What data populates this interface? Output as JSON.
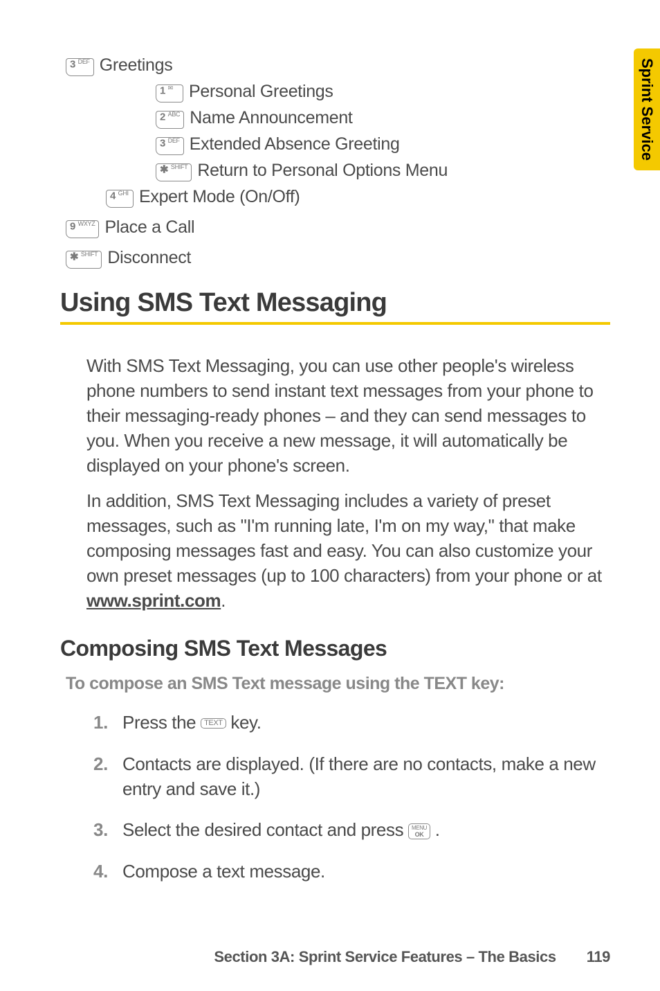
{
  "tab": "Sprint Service",
  "menu": {
    "greetings": {
      "key": "3 DEF",
      "label": "Greetings"
    },
    "personal": {
      "key": "1",
      "label": "Personal Greetings"
    },
    "name_ann": {
      "key": "2 ABC",
      "label": "Name Announcement"
    },
    "ext_abs": {
      "key": "3 DEF",
      "label": "Extended Absence Greeting"
    },
    "return_opts": {
      "key": "* SHIFT",
      "label": "Return to Personal Options Menu"
    },
    "expert": {
      "key": "4 GHI",
      "label": "Expert Mode (On/Off)"
    },
    "place_call": {
      "key": "9 WXYZ",
      "label": "Place a Call"
    },
    "disconnect": {
      "key": "* SHIFT",
      "label": "Disconnect"
    }
  },
  "heading": "Using SMS Text Messaging",
  "para1": "With SMS Text Messaging, you can use other people's wireless phone numbers to send instant text messages from your phone to their messaging-ready phones – and they can send messages to you. When you receive a new message, it will automatically be displayed on your phone's screen.",
  "para2a": "In addition, SMS Text Messaging includes a variety of preset messages, such as \"I'm running late, I'm on my way,\" that make composing messages fast and easy. You can also customize your own preset messages (up to 100 characters) from your phone or at ",
  "para2_link": "www.sprint.com",
  "para2b": ".",
  "subheading": "Composing SMS Text Messages",
  "instruction": "To compose an SMS Text message using the TEXT key:",
  "steps": {
    "s1a": "Press the ",
    "s1key": "TEXT",
    "s1b": " key.",
    "s2": "Contacts are displayed. (If there are no contacts, make a new entry and save it.)",
    "s3a": "Select the desired contact and press ",
    "s3key": "MENU OK",
    "s3b": " .",
    "s4": "Compose a text message."
  },
  "footer": {
    "section": "Section 3A: Sprint Service Features – The Basics",
    "page": "119"
  }
}
